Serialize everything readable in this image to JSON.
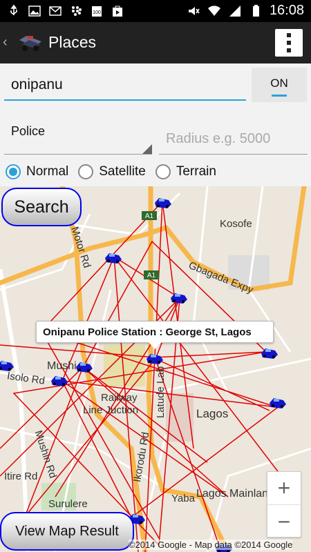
{
  "status_bar": {
    "time": "16:08",
    "icons": [
      "usb-icon",
      "image-icon",
      "email-icon",
      "blackberry-icon",
      "battery-100-icon",
      "play-store-icon",
      "mute-icon",
      "wifi-icon",
      "signal-icon",
      "battery-icon"
    ]
  },
  "action_bar": {
    "title": "Places",
    "back_icon": "chevron-left-icon",
    "menu_icon": "overflow-menu-icon"
  },
  "form": {
    "query_value": "onipanu",
    "toggle_label": "ON",
    "place_type": "Police",
    "radius_placeholder": "Radius e.g. 5000",
    "map_types": [
      {
        "label": "Normal",
        "selected": true
      },
      {
        "label": "Satellite",
        "selected": false
      },
      {
        "label": "Terrain",
        "selected": false
      }
    ]
  },
  "buttons": {
    "search_label": "Search",
    "view_result_label": "View Map Result"
  },
  "map": {
    "info_window": "Onipanu Police Station : George St, Lagos",
    "labels": {
      "kosofe": "Kosofe",
      "gbagada": "Gbagada Expy",
      "motor_rd": "Motor Rd",
      "a1_top": "A1",
      "a1_mid": "A1",
      "mushin": "Mushi",
      "isolo": "Isolo Rd",
      "railway": "Railway",
      "line_juction": "Line Juction",
      "latude": "Latude Lab",
      "lagos": "Lagos",
      "ikorodu": "Ikorodu Rd",
      "mushin_rd": "Mushin Rd",
      "itire": "Itire Rd",
      "surulere": "Surulere",
      "yaba": "Yaba",
      "lagos_mainland": "Lagos Mainland"
    },
    "zoom_in": "+",
    "zoom_out": "−",
    "copyright": "©2014 Google - Map data ©2014 Google"
  },
  "colors": {
    "accent": "#2ea0d8",
    "route_lines": "#e00000",
    "road_major": "#f6b74c"
  }
}
